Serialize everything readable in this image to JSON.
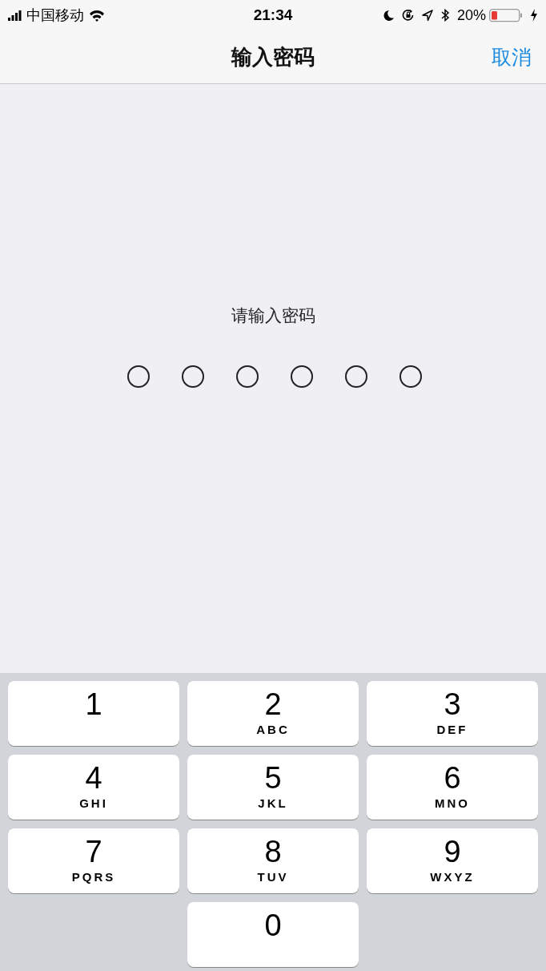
{
  "status_bar": {
    "carrier": "中国移动",
    "time": "21:34",
    "battery_percent": "20%"
  },
  "nav_bar": {
    "title": "输入密码",
    "cancel": "取消"
  },
  "prompt": "请输入密码",
  "passcode_dots": [
    {
      "filled": false
    },
    {
      "filled": false
    },
    {
      "filled": false
    },
    {
      "filled": false
    },
    {
      "filled": false
    },
    {
      "filled": false
    }
  ],
  "keypad": [
    {
      "digit": "1"
    },
    {
      "digit": "2",
      "letters": "ABC"
    },
    {
      "digit": "3",
      "letters": "DEF"
    },
    {
      "digit": "4",
      "letters": "GHI"
    },
    {
      "digit": "5",
      "letters": "JKL"
    },
    {
      "digit": "6",
      "letters": "MNO"
    },
    {
      "digit": "7",
      "letters": "PQRS"
    },
    {
      "digit": "8",
      "letters": "TUV"
    },
    {
      "digit": "9",
      "letters": "WXYZ"
    },
    {
      "digit": "0"
    }
  ]
}
